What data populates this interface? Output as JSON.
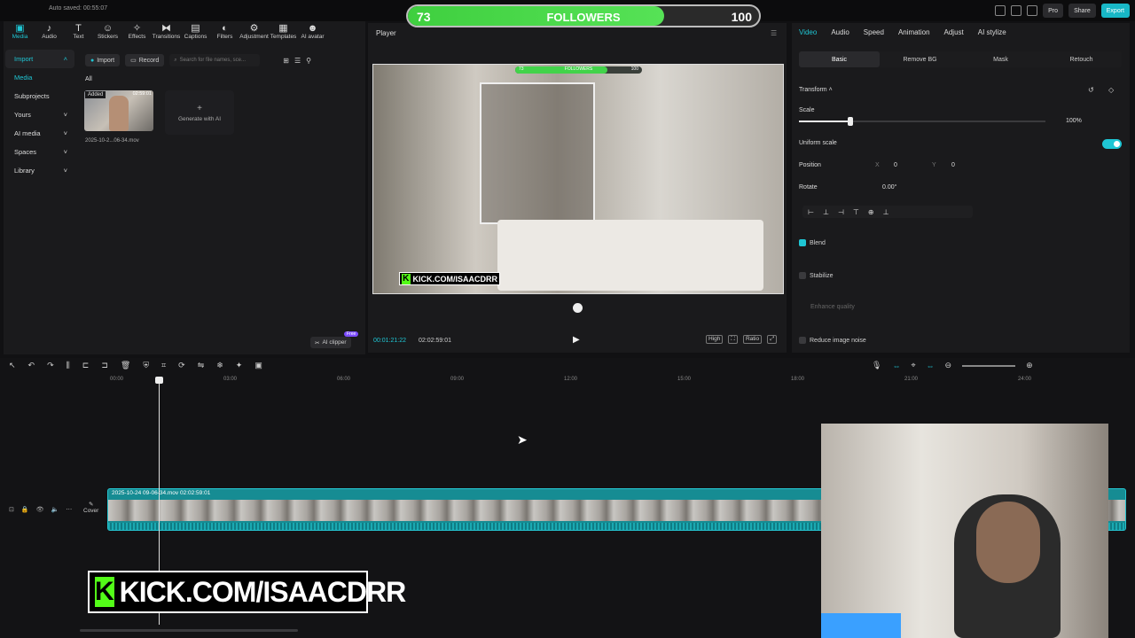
{
  "topbar": {
    "autosave": "Auto saved: 00:55:07",
    "pro": "Pro",
    "share": "Share",
    "export": "Export"
  },
  "overlay": {
    "followers_current": "73",
    "followers_label": "FOLLOWERS",
    "followers_goal": "100",
    "followers_progress": 0.73,
    "kick_text": "KICK.COM/ISAACDRR",
    "kick_logo": "K"
  },
  "toolbar": [
    "Media",
    "Audio",
    "Text",
    "Stickers",
    "Effects",
    "Transitions",
    "Captions",
    "Filters",
    "Adjustment",
    "Templates",
    "AI avatar"
  ],
  "toolbar_icons": [
    "media-icon",
    "audio-icon",
    "text-icon",
    "stickers-icon",
    "effects-icon",
    "transitions-icon",
    "captions-icon",
    "filters-icon",
    "adjustment-icon",
    "templates-icon",
    "ai-avatar-icon"
  ],
  "leftnav": {
    "import": "Import",
    "media": "Media",
    "subprojects": "Subprojects",
    "yours": "Yours",
    "ai_media": "AI media",
    "spaces": "Spaces",
    "library": "Library"
  },
  "media": {
    "import_btn": "Import",
    "record_btn": "Record",
    "search_placeholder": "Search for file names, sce...",
    "filter_all": "All",
    "added_badge": "Added",
    "thumb_duration": "02:59:01",
    "file_name": "2025-10-2...06-34.mov",
    "generate": "Generate with AI",
    "ai_clipper": "AI clipper",
    "free": "Free"
  },
  "player": {
    "title": "Player",
    "time_current": "00:01:21:22",
    "time_total": "02:02:59:01",
    "ctrl_high": "High",
    "ctrl_ratio": "Ratio"
  },
  "props": {
    "tabs": [
      "Video",
      "Audio",
      "Speed",
      "Animation",
      "Adjust",
      "AI stylize"
    ],
    "subtabs": [
      "Basic",
      "Remove BG",
      "Mask",
      "Retouch"
    ],
    "transform": "Transform",
    "scale": "Scale",
    "scale_value": "100%",
    "scale_fraction": 0.21,
    "uniform_scale": "Uniform scale",
    "position": "Position",
    "pos_x_label": "X",
    "pos_x": "0",
    "pos_y_label": "Y",
    "pos_y": "0",
    "rotate": "Rotate",
    "rotate_value": "0.00°",
    "blend": "Blend",
    "stabilize": "Stabilize",
    "enhance_quality": "Enhance quality",
    "reduce_noise": "Reduce image noise"
  },
  "timeline": {
    "ruler": [
      "00:00",
      "03:00",
      "06:00",
      "09:00",
      "12:00",
      "15:00",
      "18:00",
      "21:00",
      "24:00"
    ],
    "clip_label": "2025-10-24 09-06-34.mov   02:02:59:01",
    "cover": "Cover"
  }
}
